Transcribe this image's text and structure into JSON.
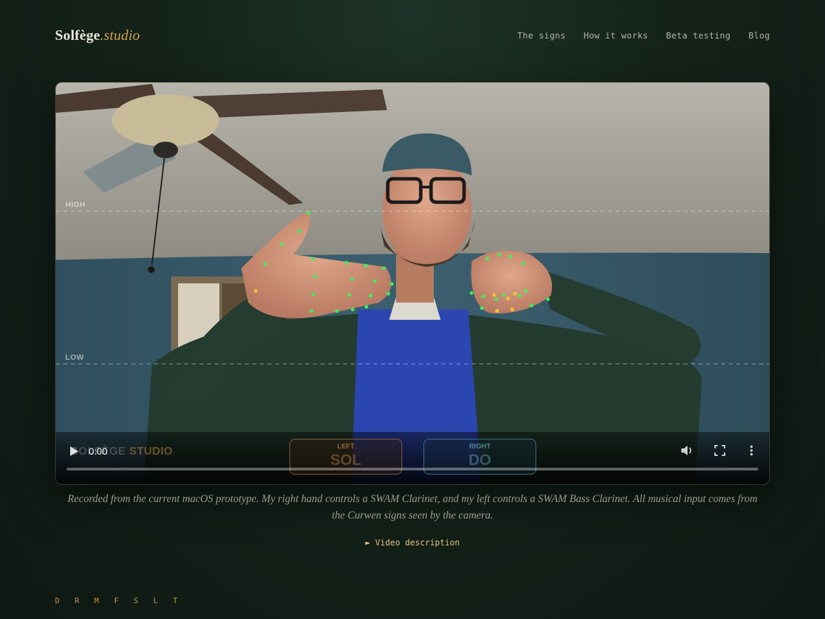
{
  "brand": {
    "name": "Solfège",
    "accent": ".studio"
  },
  "nav": [
    {
      "label": "The signs"
    },
    {
      "label": "How it works"
    },
    {
      "label": "Beta testing"
    },
    {
      "label": "Blog"
    }
  ],
  "video": {
    "guides": {
      "high": "HIGH",
      "low": "LOW"
    },
    "watermark": {
      "part1": "SOLFÈGE",
      "part2": "STUDIO"
    },
    "left_hand": {
      "label": "LEFT",
      "value": "SOL"
    },
    "right_hand": {
      "label": "RIGHT",
      "value": "DO"
    },
    "time": "0:00",
    "progress": 0
  },
  "caption": "Recorded from the current macOS prototype. My right hand controls a SWAM Clarinet, and my left controls a SWAM Bass Clarinet. All musical input comes from the Curwen signs seen by the camera.",
  "description_toggle": "► Video description",
  "scale_letters": [
    "D",
    "R",
    "M",
    "F",
    "S",
    "L",
    "T"
  ],
  "colors": {
    "accent": "#d4a34a",
    "landmark_green": "#3ef05a",
    "landmark_yellow": "#f2c23c"
  }
}
